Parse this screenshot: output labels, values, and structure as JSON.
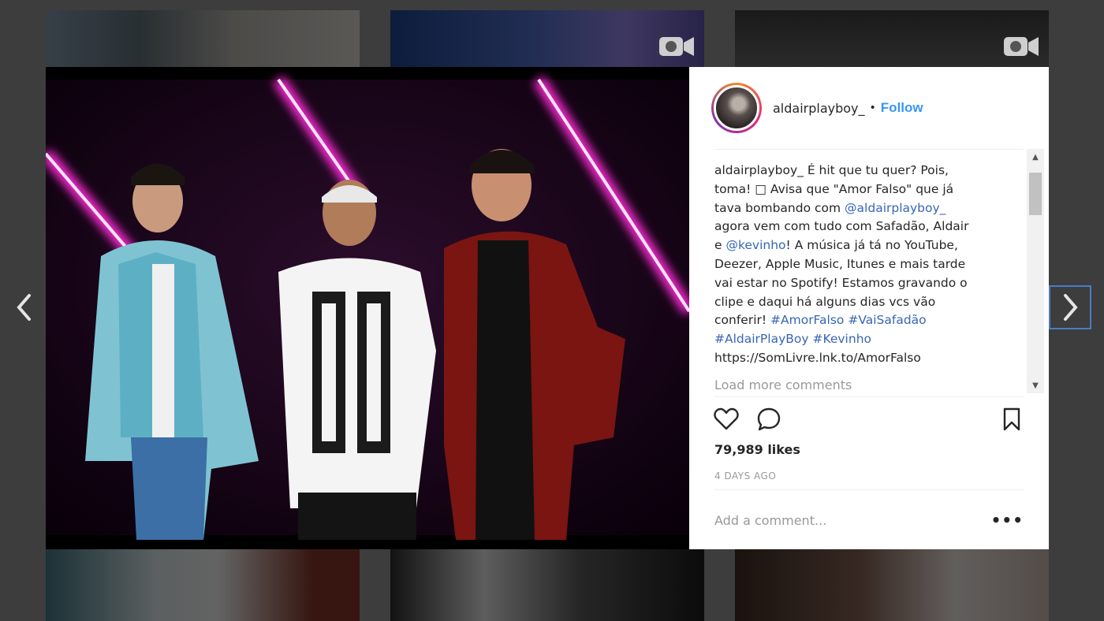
{
  "post": {
    "username": "aldairplayboy_",
    "follow_label": "Follow",
    "caption_user": "aldairplayboy_",
    "caption_lines": [
      "É hit que tu quer? Pois,",
      "toma! □ Avisa que \"Amor Falso\" que já",
      "tava bombando com ",
      "agora vem com tudo com Safadão, Aldair",
      "e ",
      "! A música já tá no YouTube,",
      "Deezer, Apple Music, Itunes e mais tarde",
      "vai estar no Spotify! Estamos gravando o",
      "clipe e daqui há alguns dias vcs vão",
      "conferir! "
    ],
    "mention_1": "@aldairplayboy_",
    "mention_2": "@kevinho",
    "hashtag_1": "#AmorFalso",
    "hashtag_2": "#VaiSafadão",
    "hashtag_3": "#AldairPlayBoy",
    "hashtag_4": "#Kevinho",
    "link": "https://SomLivre.lnk.to/AmorFalso",
    "load_more": "Load more comments",
    "likes": "79,989 likes",
    "time_ago": "4 DAYS AGO",
    "comment_placeholder": "Add a comment...",
    "more_options": "•••"
  },
  "icons": [
    "chevron-left-icon",
    "chevron-right-icon",
    "heart-icon",
    "comment-icon",
    "bookmark-icon",
    "video-icon"
  ],
  "colors": {
    "accent": "#3897f0",
    "tag": "#3866b5",
    "muted": "#999999",
    "neon": "#ff3cff"
  }
}
